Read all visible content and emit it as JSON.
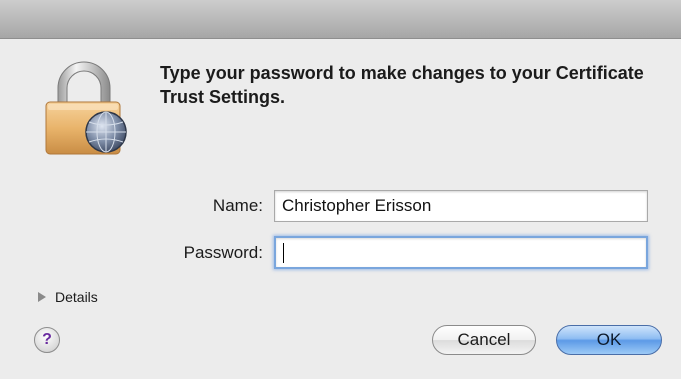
{
  "dialog": {
    "message": "Type your password to make changes to your Certificate Trust Settings.",
    "name_label": "Name:",
    "name_value": "Christopher Erisson",
    "password_label": "Password:",
    "password_value": "",
    "details_label": "Details",
    "help_label": "?",
    "cancel_label": "Cancel",
    "ok_label": "OK"
  },
  "icons": {
    "lock": "lock-icon",
    "globe": "globe-icon",
    "disclosure": "disclosure-triangle-icon",
    "help": "help-icon"
  },
  "colors": {
    "dialog_bg": "#ececec",
    "default_button": "#5c9ae7",
    "focus_ring": "#7aa6dd",
    "help_glyph": "#6a2ca0"
  }
}
